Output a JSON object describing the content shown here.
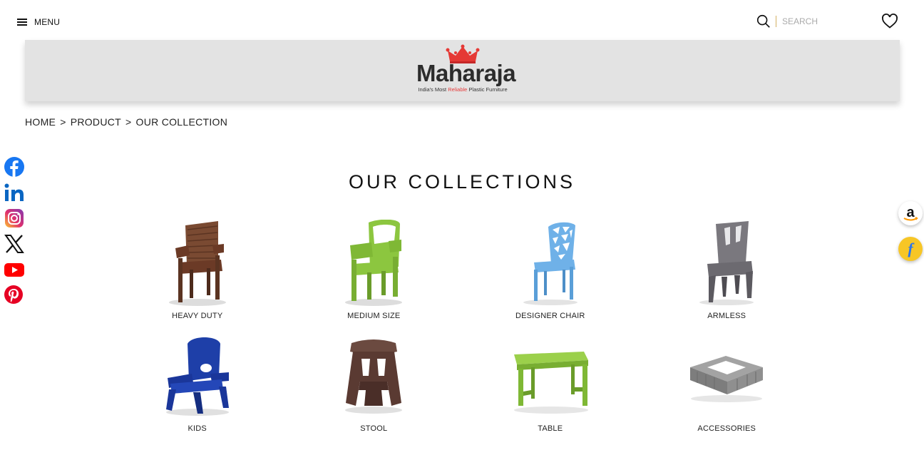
{
  "header": {
    "menu_label": "MENU",
    "search_placeholder": "SEARCH"
  },
  "brand": {
    "name": "Maharaja",
    "tagline_before": "India's Most ",
    "tagline_highlight": "Reliable",
    "tagline_after": " Plastic Furniture"
  },
  "breadcrumb": {
    "items": [
      "HOME",
      "PRODUCT",
      "OUR COLLECTION"
    ],
    "separator": ">"
  },
  "page_title": "OUR COLLECTIONS",
  "collections": [
    {
      "label": "HEAVY DUTY",
      "color": "#6b3a26"
    },
    {
      "label": "MEDIUM SIZE",
      "color": "#8cc63f"
    },
    {
      "label": "DESIGNER CHAIR",
      "color": "#6fb1e8"
    },
    {
      "label": "ARMLESS",
      "color": "#6c6a70"
    },
    {
      "label": "KIDS",
      "color": "#1e3fa8"
    },
    {
      "label": "STOOL",
      "color": "#5a3a32"
    },
    {
      "label": "TABLE",
      "color": "#8cc63f"
    },
    {
      "label": "ACCESSORIES",
      "color": "#8f8f8f"
    }
  ],
  "social": [
    "facebook-icon",
    "linkedin-icon",
    "instagram-icon",
    "x-icon",
    "youtube-icon",
    "pinterest-icon"
  ],
  "side_apps": [
    "amazon-icon",
    "flipkart-icon"
  ]
}
